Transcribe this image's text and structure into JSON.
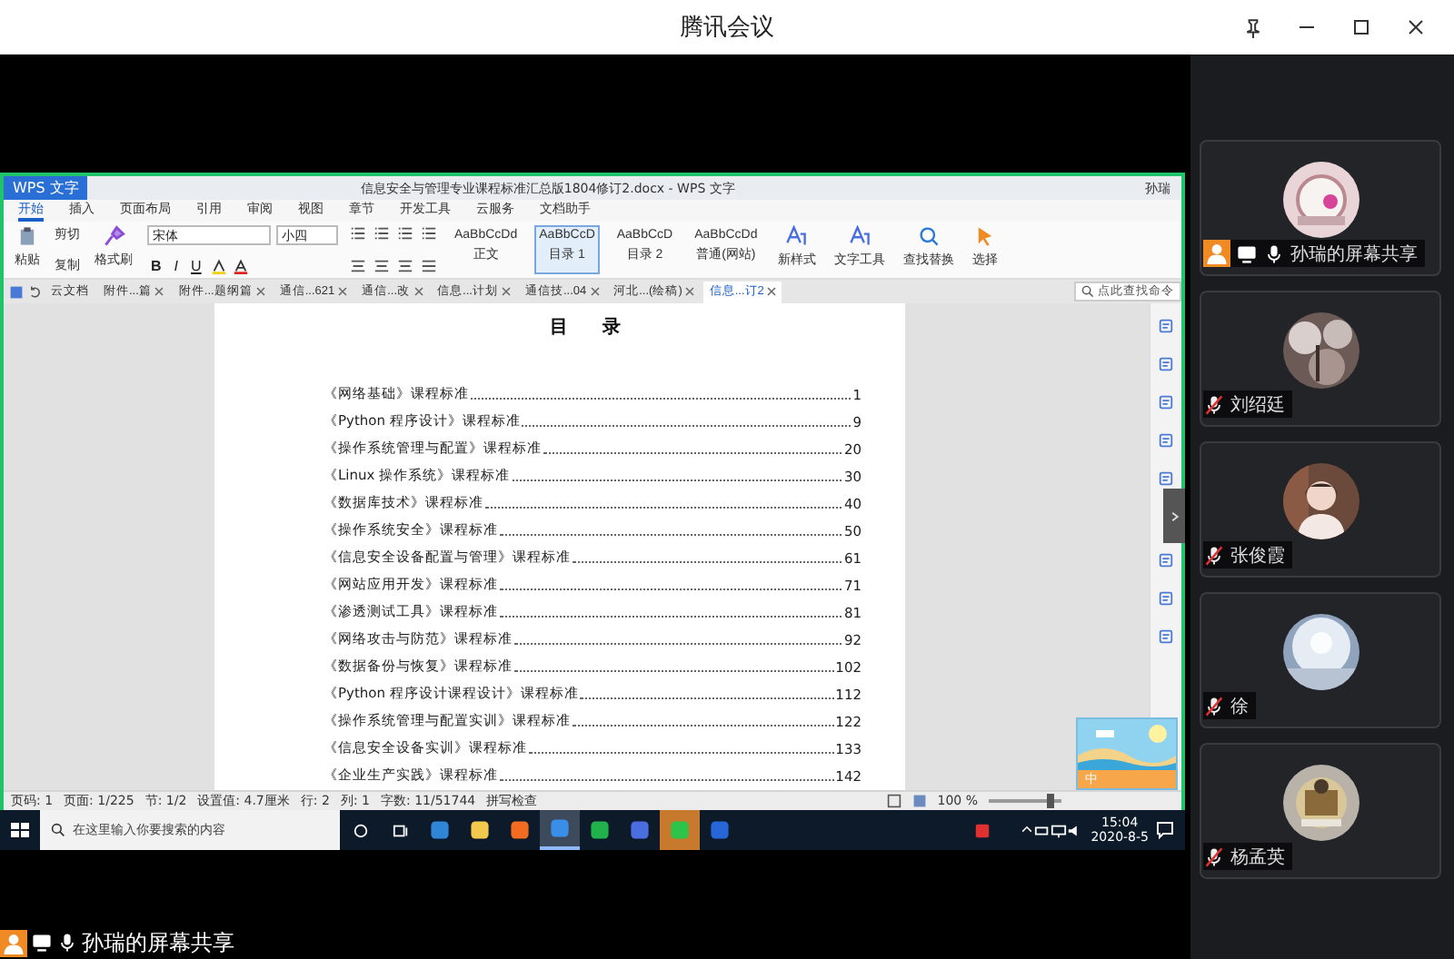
{
  "app": {
    "title": "腾讯会议"
  },
  "wps": {
    "app_tab": "WPS 文字",
    "doc_title": "信息安全与管理专业课程标准汇总版1804修订2.docx - WPS 文字",
    "user": "孙瑞",
    "menu": [
      {
        "label": "开始",
        "selected": true
      },
      {
        "label": "插入",
        "selected": false
      },
      {
        "label": "页面布局",
        "selected": false
      },
      {
        "label": "引用",
        "selected": false
      },
      {
        "label": "审阅",
        "selected": false
      },
      {
        "label": "视图",
        "selected": false
      },
      {
        "label": "章节",
        "selected": false
      },
      {
        "label": "开发工具",
        "selected": false
      },
      {
        "label": "云服务",
        "selected": false
      },
      {
        "label": "文档助手",
        "selected": false
      }
    ],
    "clipboard": {
      "paste": "粘贴",
      "cut": "剪切",
      "copy": "复制",
      "format_painter": "格式刷"
    },
    "font": {
      "family": "宋体",
      "size": "小四"
    },
    "format_buttons": [
      "B",
      "I",
      "U"
    ],
    "styles": [
      {
        "sample": "AaBbCcDd",
        "label": "正文",
        "selected": false
      },
      {
        "sample": "AaBbCcD",
        "label": "目录 1",
        "selected": true
      },
      {
        "sample": "AaBbCcD",
        "label": "目录 2",
        "selected": false
      },
      {
        "sample": "AaBbCcDd",
        "label": "普通(网站)",
        "selected": false
      }
    ],
    "tools": [
      "新样式",
      "文字工具",
      "查找替换",
      "选择"
    ],
    "cloud": "云文档",
    "doc_tabs": [
      {
        "label": "附件...篇",
        "selected": false
      },
      {
        "label": "附件...题纲篇",
        "selected": false
      },
      {
        "label": "通信...621",
        "selected": false
      },
      {
        "label": "通信...改",
        "selected": false
      },
      {
        "label": "信息...计划",
        "selected": false
      },
      {
        "label": "通信技...04",
        "selected": false
      },
      {
        "label": "河北...(绘稿)",
        "selected": false
      },
      {
        "label": "信息...订2",
        "selected": true
      }
    ],
    "command_search": {
      "placeholder": "点此查找命令"
    },
    "document": {
      "heading": "目 录",
      "toc": [
        {
          "title": "《网络基础》课程标准",
          "page": "1"
        },
        {
          "title": "《Python 程序设计》课程标准",
          "page": "9"
        },
        {
          "title": "《操作系统管理与配置》课程标准",
          "page": "20"
        },
        {
          "title": "《Linux 操作系统》课程标准",
          "page": "30"
        },
        {
          "title": "《数据库技术》课程标准",
          "page": "40"
        },
        {
          "title": "《操作系统安全》课程标准",
          "page": "50"
        },
        {
          "title": "《信息安全设备配置与管理》课程标准",
          "page": "61"
        },
        {
          "title": "《网站应用开发》课程标准",
          "page": "71"
        },
        {
          "title": "《渗透测试工具》课程标准",
          "page": "81"
        },
        {
          "title": "《网络攻击与防范》课程标准",
          "page": "92"
        },
        {
          "title": "《数据备份与恢复》课程标准",
          "page": "102"
        },
        {
          "title": "《Python 程序设计课程设计》课程标准",
          "page": "112"
        },
        {
          "title": "《操作系统管理与配置实训》课程标准",
          "page": "122"
        },
        {
          "title": "《信息安全设备实训》课程标准",
          "page": "133"
        },
        {
          "title": "《企业生产实践》课程标准",
          "page": "142"
        }
      ]
    },
    "status": [
      "页码: 1",
      "页面: 1/225",
      "节: 1/2",
      "设置值: 4.7厘米",
      "行: 2",
      "列: 1",
      "字数: 11/51744",
      "拼写检查"
    ],
    "zoom": {
      "reading": "100 %",
      "level": 0.85
    },
    "ime": {
      "label": "中"
    }
  },
  "taskbar": {
    "search": {
      "placeholder": "在这里输入你要搜索的内容"
    },
    "apps": [
      {
        "kind": "edge",
        "selected": false,
        "alert": false
      },
      {
        "kind": "explorer",
        "selected": false,
        "alert": false
      },
      {
        "kind": "firefox",
        "selected": false,
        "alert": false
      },
      {
        "kind": "writer",
        "selected": true,
        "alert": false
      },
      {
        "kind": "sheet",
        "selected": false,
        "alert": false
      },
      {
        "kind": "meeting",
        "selected": false,
        "alert": false
      },
      {
        "kind": "wechat",
        "selected": false,
        "alert": true
      },
      {
        "kind": "cloud",
        "selected": false,
        "alert": false
      }
    ],
    "clock": {
      "time": "15:04",
      "date": "2020-8-5"
    }
  },
  "participants": [
    {
      "name": "孙瑞的屏幕共享",
      "host": true,
      "sharing": true,
      "muted": false
    },
    {
      "name": "刘绍廷",
      "host": false,
      "sharing": false,
      "muted": true
    },
    {
      "name": "张俊霞",
      "host": false,
      "sharing": false,
      "muted": true
    },
    {
      "name": "徐",
      "host": false,
      "sharing": false,
      "muted": true
    },
    {
      "name": "杨孟英",
      "host": false,
      "sharing": false,
      "muted": true
    }
  ],
  "share_label": {
    "text": "孙瑞的屏幕共享",
    "host": true,
    "sharing": true,
    "muted": false
  }
}
